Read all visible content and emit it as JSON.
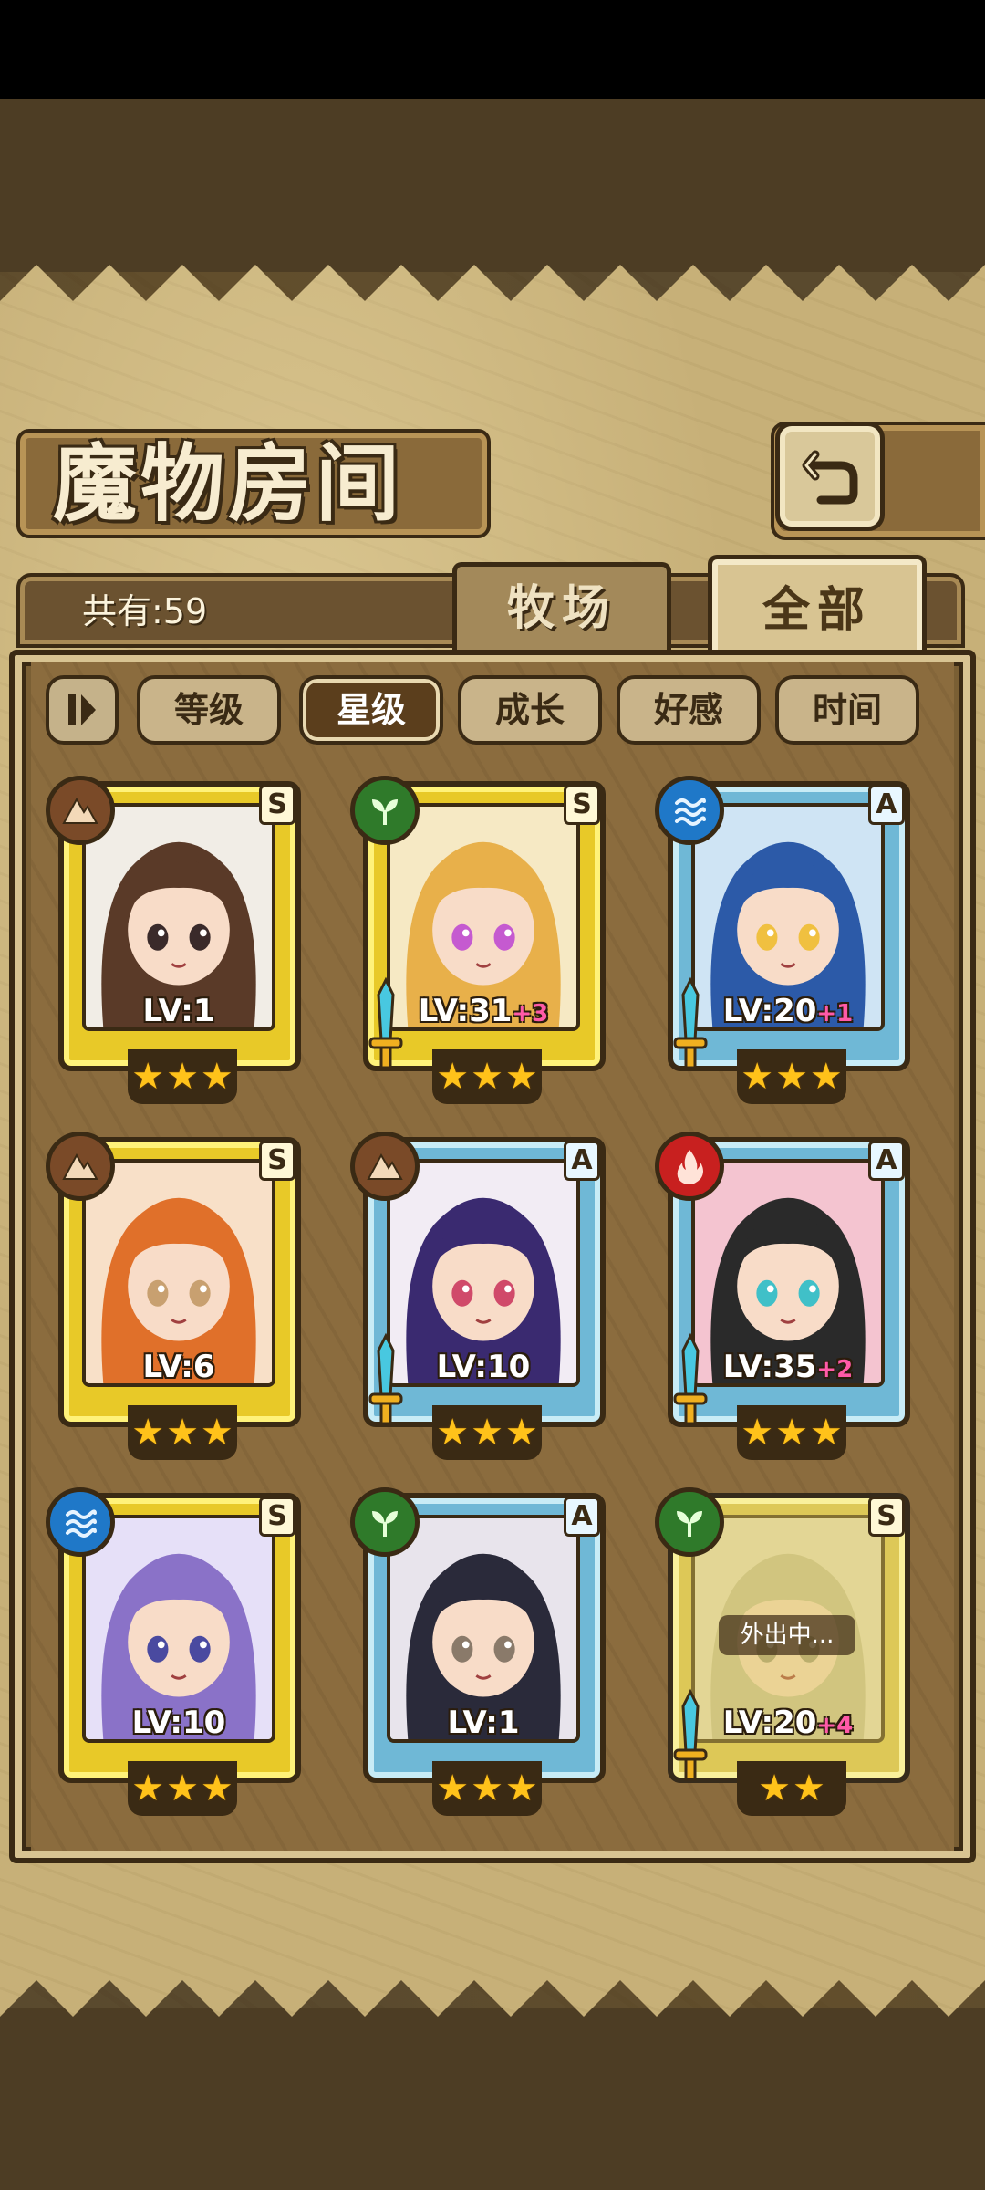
{
  "header": {
    "title": "魔物房间",
    "back_icon": "return-arrow-icon"
  },
  "summary": {
    "count_text": "共有:59"
  },
  "tabs": [
    {
      "label": "牧场",
      "active": false
    },
    {
      "label": "全部",
      "active": true
    }
  ],
  "filters": {
    "toggle_icon": "sort-order-icon",
    "items": [
      {
        "label": "等级",
        "active": false
      },
      {
        "label": "星级",
        "active": true
      },
      {
        "label": "成长",
        "active": false
      },
      {
        "label": "好感",
        "active": false
      },
      {
        "label": "时间",
        "active": false
      }
    ]
  },
  "monsters": [
    {
      "level": "LV:1",
      "plus": "",
      "rank": "S",
      "element": "earth",
      "frame": "gold",
      "stars": 3,
      "weapon": false,
      "status": ""
    },
    {
      "level": "LV:31",
      "plus": "+3",
      "rank": "S",
      "element": "plant",
      "frame": "gold",
      "stars": 3,
      "weapon": true,
      "status": ""
    },
    {
      "level": "LV:20",
      "plus": "+1",
      "rank": "A",
      "element": "water",
      "frame": "blue",
      "stars": 3,
      "weapon": true,
      "status": ""
    },
    {
      "level": "LV:6",
      "plus": "",
      "rank": "S",
      "element": "earth",
      "frame": "gold",
      "stars": 3,
      "weapon": false,
      "status": ""
    },
    {
      "level": "LV:10",
      "plus": "",
      "rank": "A",
      "element": "earth",
      "frame": "blue",
      "stars": 3,
      "weapon": true,
      "status": ""
    },
    {
      "level": "LV:35",
      "plus": "+2",
      "rank": "A",
      "element": "fire",
      "frame": "blue",
      "stars": 3,
      "weapon": true,
      "status": ""
    },
    {
      "level": "LV:10",
      "plus": "",
      "rank": "S",
      "element": "water",
      "frame": "gold",
      "stars": 3,
      "weapon": false,
      "status": ""
    },
    {
      "level": "LV:1",
      "plus": "",
      "rank": "A",
      "element": "plant",
      "frame": "blue",
      "stars": 3,
      "weapon": false,
      "status": ""
    },
    {
      "level": "LV:20",
      "plus": "+4",
      "rank": "S",
      "element": "plant",
      "frame": "gold",
      "stars": 2,
      "weapon": true,
      "status": "外出中..."
    }
  ],
  "colors": {
    "parchment": "#c7b078",
    "frame_gold": "#e8c928",
    "frame_blue": "#6fb8d6",
    "star": "#ffc21a",
    "plus_text": "#ff5aa8",
    "active_filter": "#5b3e1c"
  }
}
